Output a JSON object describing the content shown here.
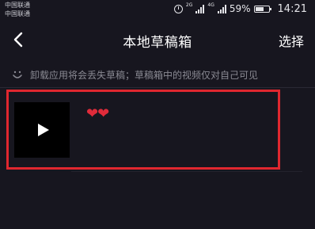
{
  "status_bar": {
    "carrier_line1": "中国联通",
    "carrier_line2": "中国联通",
    "network_tag_1": "2G",
    "network_tag_2": "4G",
    "battery_percent": "59%",
    "battery_level": 0.59,
    "time": "14:21",
    "icons": [
      "alarm-icon",
      "signal-icon",
      "signal-icon",
      "battery-icon"
    ]
  },
  "nav": {
    "back_icon": "chevron-left-icon",
    "title": "本地草稿箱",
    "select_label": "选择"
  },
  "notice": {
    "icon": "smile-icon",
    "text": "卸载应用将会丢失草稿；草稿箱中的视频仅对自己可见"
  },
  "drafts": [
    {
      "caption": "❤❤",
      "thumbnail_icon": "play-icon",
      "highlighted": true
    }
  ],
  "colors": {
    "background": "#17161f",
    "highlight_border": "#e0272f",
    "notice_text": "#8a8a93",
    "heart": "#e02b3a"
  }
}
